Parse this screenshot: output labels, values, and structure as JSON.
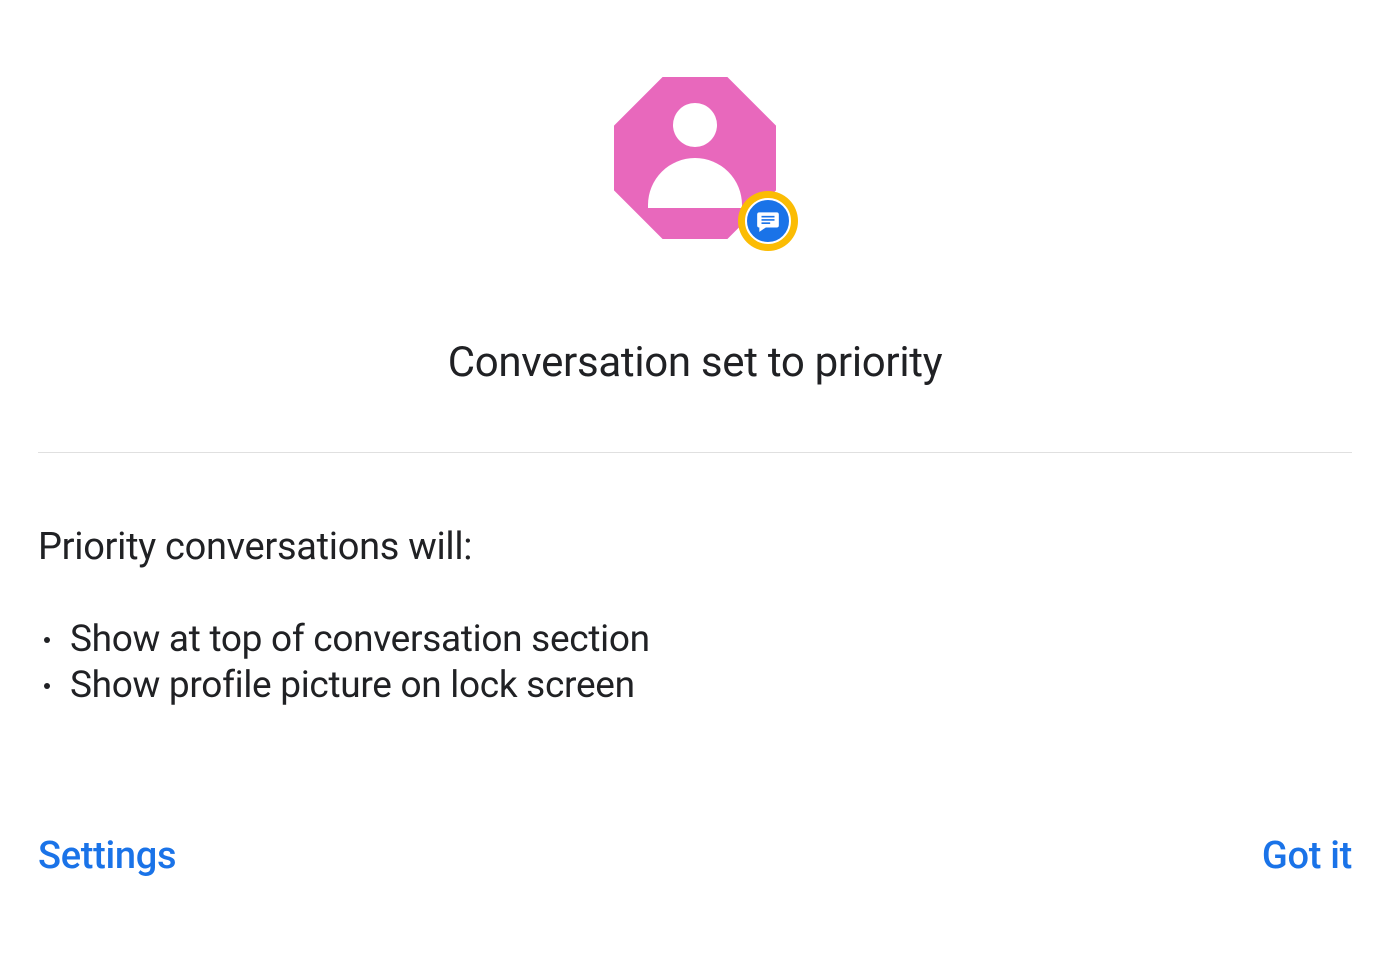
{
  "dialog": {
    "title": "Conversation set to priority",
    "subtitle": "Priority conversations will:",
    "bullets": [
      "Show at top of conversation section",
      "Show profile picture on lock screen"
    ]
  },
  "footer": {
    "settings_label": "Settings",
    "confirm_label": "Got it"
  },
  "colors": {
    "accent": "#1a73e8",
    "avatar_bg": "#e868bc",
    "badge_ring": "#fbbc04"
  }
}
